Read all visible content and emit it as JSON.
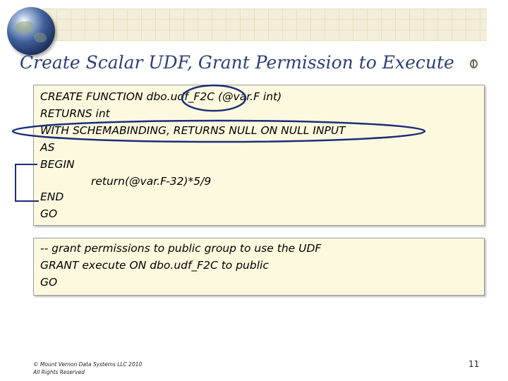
{
  "slide": {
    "title": "Create Scalar UDF, Grant Permission to Execute",
    "page_number": "11"
  },
  "code_block_main": {
    "lines": [
      "CREATE FUNCTION dbo.udf_F2C (@var.F int)",
      "RETURNS int",
      "WITH SCHEMABINDING, RETURNS NULL ON NULL INPUT",
      "AS",
      "BEGIN",
      "return(@var.F-32)*5/9",
      "END",
      "GO"
    ]
  },
  "code_block_grant": {
    "lines": [
      "-- grant permissions to public group to use the UDF",
      "GRANT execute ON dbo.udf_F2C to public",
      "GO"
    ]
  },
  "footer": {
    "copyright": "© Mount Vernon Data Systems LLC 2010",
    "rights": "All Rights Reserved"
  },
  "colors": {
    "title": "#2c3f74",
    "annotation_ellipse": "#1b2d7a",
    "code_background": "#fdf9de",
    "header_band": "#f3eed9"
  },
  "icons": [
    "globe-logo-icon",
    "title-mark-icon"
  ]
}
